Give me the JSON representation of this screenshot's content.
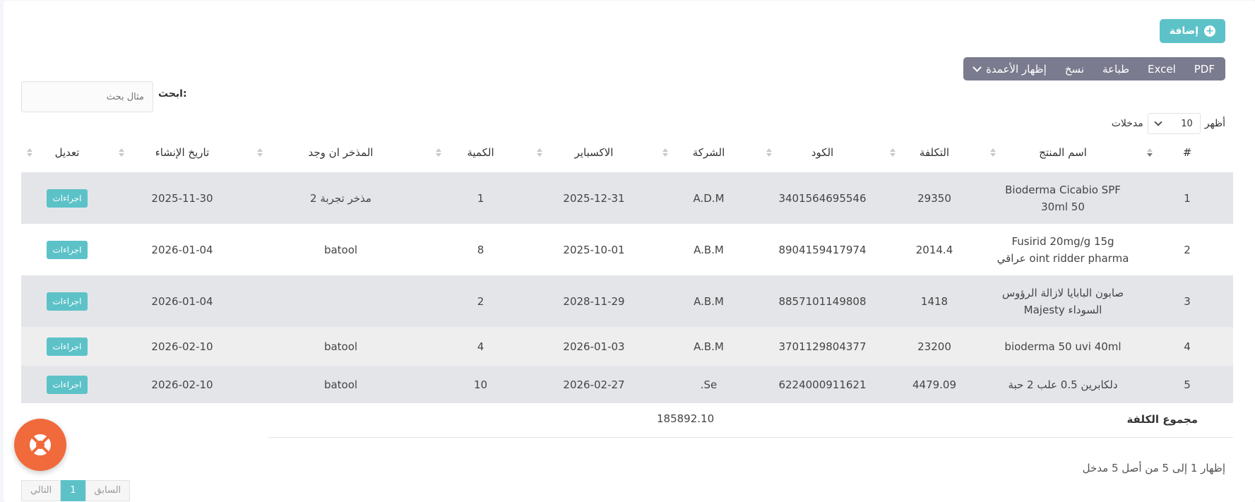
{
  "add_button": {
    "label": "إضافة",
    "icon": "plus-circle-icon"
  },
  "toolbar": {
    "pdf": "PDF",
    "excel": "Excel",
    "print": "طباعة",
    "copy": "نسخ",
    "columns": "إظهار الأعمدة"
  },
  "search": {
    "label": "ابحث:",
    "placeholder": "مثال بحث"
  },
  "length": {
    "show": "أظهر",
    "value": "10",
    "entries": "مدخلات"
  },
  "table": {
    "headers": [
      "#",
      "اسم المنتج",
      "التكلفة",
      "الكود",
      "الشركة",
      "الاكسباير",
      "الكمية",
      "المذخر ان وجد",
      "تاريخ الإنشاء",
      "تعديل"
    ],
    "rows": [
      {
        "num": "1",
        "name_l1": "Bioderma Cicabio SPF",
        "name_l2": "50 30ml",
        "cost": "29350",
        "code": "3401564695546",
        "company": "A.D.M",
        "expiry": "2025-12-31",
        "qty": "1",
        "supplier": "مذخر تجربة 2",
        "created": "2025-11-30",
        "action": "اجراءات"
      },
      {
        "num": "2",
        "name_l1": "Fusirid 20mg/g 15g",
        "name_l2": "oint ridder pharma عراقي",
        "cost": "2014.4",
        "code": "8904159417974",
        "company": "A.B.M",
        "expiry": "2025-10-01",
        "qty": "8",
        "supplier": "batool",
        "created": "2026-01-04",
        "action": "اجراءات"
      },
      {
        "num": "3",
        "name_l1": "صابون البابايا لازالة الرؤوس",
        "name_l2": "السوداء Majesty",
        "cost": "1418",
        "code": "8857101149808",
        "company": "A.B.M",
        "expiry": "2028-11-29",
        "qty": "2",
        "supplier": "",
        "created": "2026-01-04",
        "action": "اجراءات"
      },
      {
        "num": "4",
        "name_l1": "bioderma 50 uvi 40ml",
        "name_l2": "",
        "cost": "23200",
        "code": "3701129804377",
        "company": "A.B.M",
        "expiry": "2026-01-03",
        "qty": "4",
        "supplier": "batool",
        "created": "2026-02-10",
        "action": "اجراءات"
      },
      {
        "num": "5",
        "name_l1": "دلكابرين 0.5 علب 2 حبة",
        "name_l2": "",
        "cost": "4479.09",
        "code": "6224000911621",
        "company": "Se.",
        "expiry": "2026-02-27",
        "qty": "10",
        "supplier": "batool",
        "created": "2026-02-10",
        "action": "اجراءات"
      }
    ]
  },
  "total": {
    "label": "مجموع الكلفة",
    "value": "185892.10"
  },
  "info": "إظهار 1 إلى 5 من أصل 5 مدخل",
  "pager": {
    "prev": "السابق",
    "current": "1",
    "next": "التالي"
  },
  "colors": {
    "accent": "#5cc2c8",
    "toolbar": "#7b7b8f",
    "fab": "#f06a3c"
  }
}
